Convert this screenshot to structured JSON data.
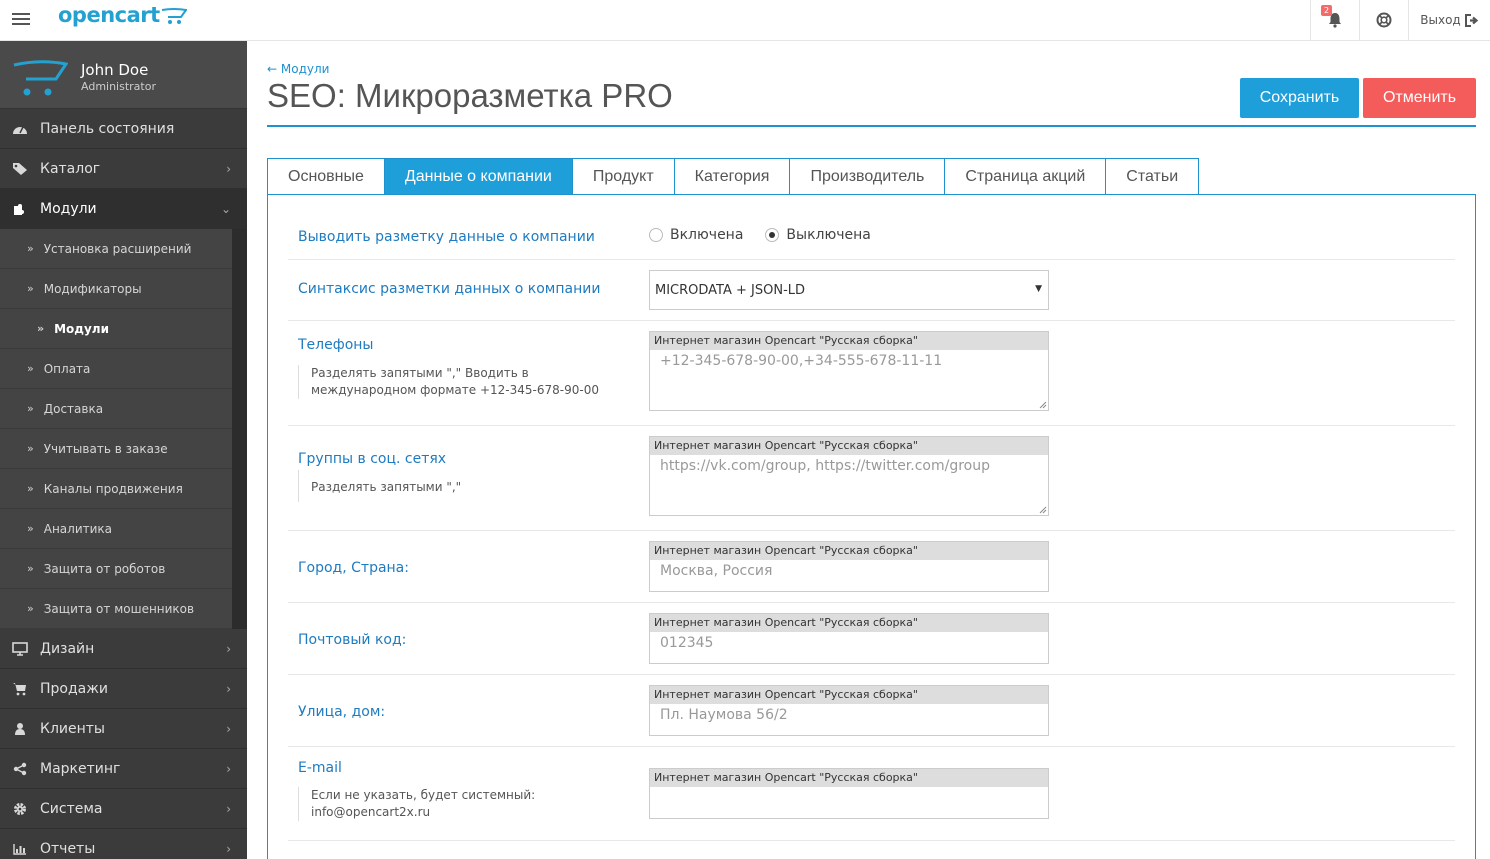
{
  "header": {
    "logo_text": "opencart",
    "notifications_count": "2",
    "logout_label": "Выход"
  },
  "profile": {
    "name": "John Doe",
    "role": "Administrator"
  },
  "sidebar": {
    "items": [
      {
        "label": "Панель состояния",
        "icon": "dashboard-icon"
      },
      {
        "label": "Каталог",
        "icon": "tag-icon"
      },
      {
        "label": "Модули",
        "icon": "puzzle-icon"
      }
    ],
    "subitems": [
      {
        "label": "Установка расширений"
      },
      {
        "label": "Модификаторы"
      },
      {
        "label": "Модули"
      },
      {
        "label": "Оплата"
      },
      {
        "label": "Доставка"
      },
      {
        "label": "Учитывать в заказе"
      },
      {
        "label": "Каналы продвижения"
      },
      {
        "label": "Аналитика"
      },
      {
        "label": "Защита от роботов"
      },
      {
        "label": "Защита от мошенников"
      }
    ],
    "bottom_items": [
      {
        "label": "Дизайн",
        "icon": "monitor-icon"
      },
      {
        "label": "Продажи",
        "icon": "cart-icon"
      },
      {
        "label": "Клиенты",
        "icon": "user-icon"
      },
      {
        "label": "Маркетинг",
        "icon": "share-icon"
      },
      {
        "label": "Система",
        "icon": "cog-icon"
      },
      {
        "label": "Отчеты",
        "icon": "bar-chart-icon"
      }
    ]
  },
  "breadcrumb": "← Модули",
  "page_title": "SEO: Микроразметка PRO",
  "buttons": {
    "save": "Сохранить",
    "cancel": "Отменить"
  },
  "tabs": [
    "Основные",
    "Данные о компании",
    "Продукт",
    "Категория",
    "Производитель",
    "Страница акций",
    "Статьи"
  ],
  "active_tab": "Данные о компании",
  "form": {
    "show_markup": {
      "label": "Выводить разметку данные о компании",
      "options": [
        "Включена",
        "Выключена"
      ],
      "selected": "Выключена"
    },
    "syntax": {
      "label": "Синтаксис разметки данных о компании",
      "value": "MICRODATA + JSON-LD"
    },
    "store_name": "Интернет магазин Opencart \"Русская сборка\"",
    "phones": {
      "label": "Телефоны",
      "help": "Разделять запятыми \",\" Вводить в международном формате +12-345-678-90-00",
      "placeholder": "+12-345-678-90-00,+34-555-678-11-11"
    },
    "social": {
      "label": "Группы в соц. сетях",
      "help": "Разделять запятыми \",\"",
      "placeholder": "https://vk.com/group, https://twitter.com/group"
    },
    "city": {
      "label": "Город, Страна:",
      "placeholder": "Москва, Россия"
    },
    "postcode": {
      "label": "Почтовый код:",
      "placeholder": "012345"
    },
    "street": {
      "label": "Улица, дом:",
      "placeholder": "Пл. Наумова 56/2"
    },
    "email": {
      "label": "E-mail",
      "help": "Если не указать, будет системный: info@opencart2x.ru",
      "placeholder": ""
    }
  },
  "colors": {
    "accent": "#1e9fd9",
    "danger": "#f45b5b",
    "sidebar": "#3b3b3b"
  }
}
